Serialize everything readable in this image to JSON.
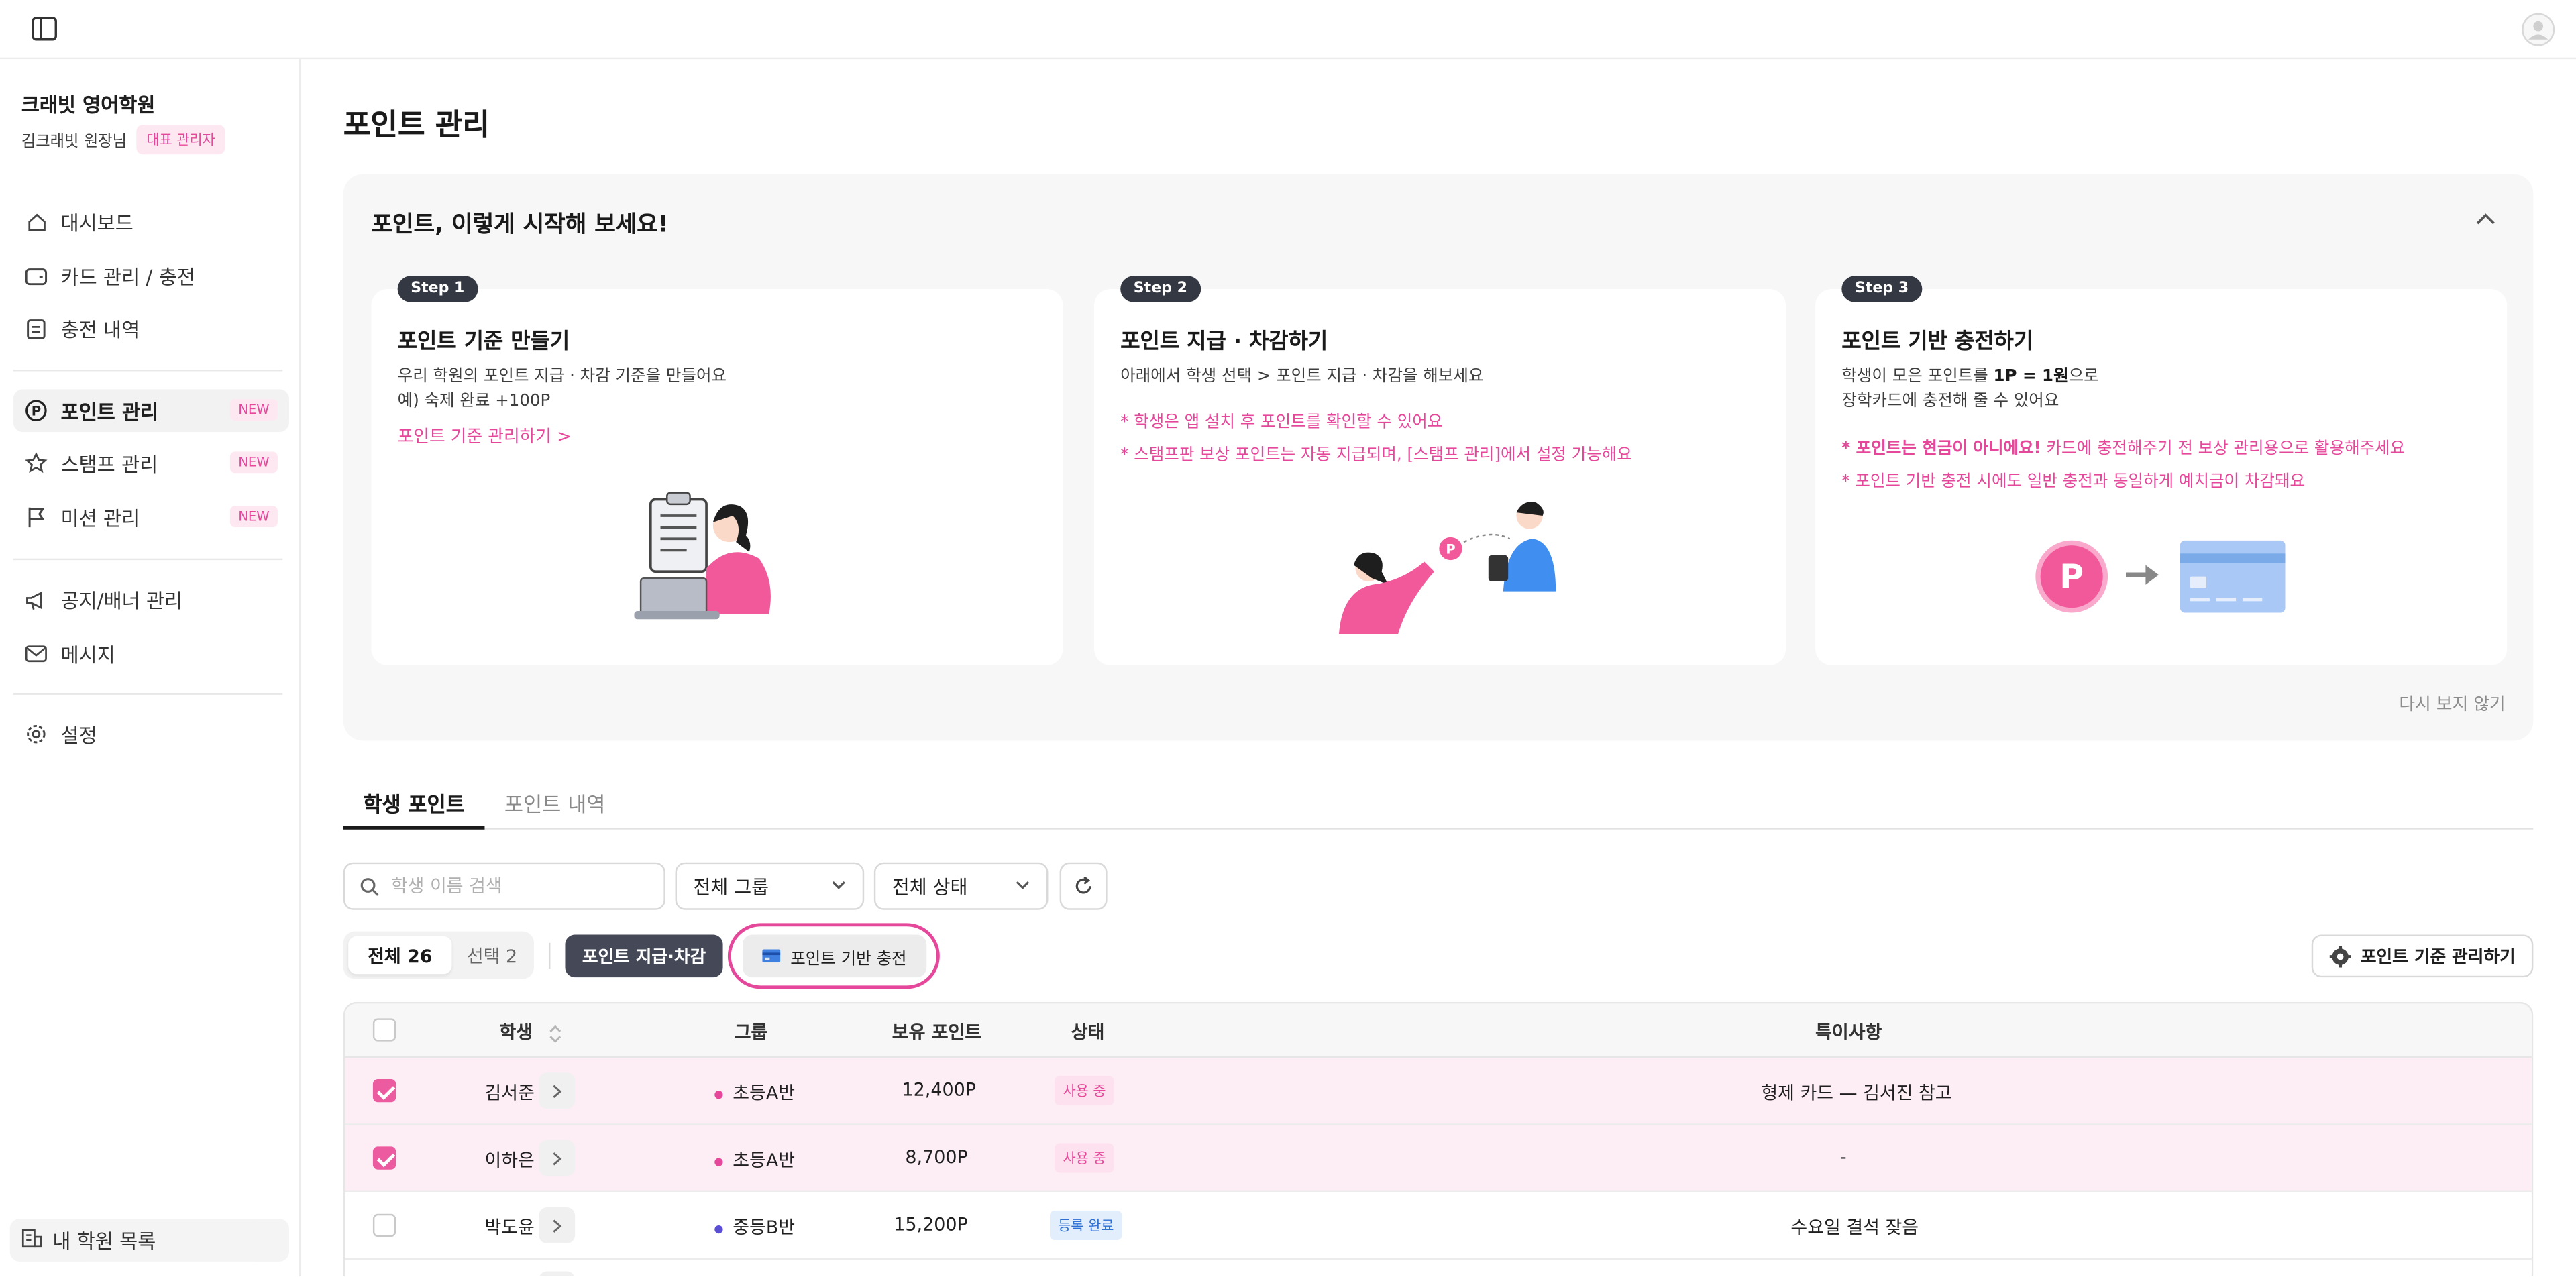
{
  "topbar": {
    "toggle_icon": "sidebar-toggle-icon",
    "avatar_icon": "user-avatar-icon"
  },
  "sidebar": {
    "academy_name": "크래빗 영어학원",
    "owner_name": "김크래빗 원장님",
    "role_badge": "대표 관리자",
    "items": [
      {
        "label": "대시보드",
        "icon": "home-icon",
        "new": ""
      },
      {
        "label": "카드 관리 / 충전",
        "icon": "wallet-icon",
        "new": ""
      },
      {
        "label": "충전 내역",
        "icon": "receipt-icon",
        "new": ""
      },
      {
        "label": "포인트 관리",
        "icon": "point-icon",
        "new": "NEW"
      },
      {
        "label": "스탬프 관리",
        "icon": "star-icon",
        "new": "NEW"
      },
      {
        "label": "미션 관리",
        "icon": "flag-icon",
        "new": "NEW"
      },
      {
        "label": "공지/배너 관리",
        "icon": "megaphone-icon",
        "new": ""
      },
      {
        "label": "메시지",
        "icon": "mail-icon",
        "new": ""
      },
      {
        "label": "설정",
        "icon": "gear-icon",
        "new": ""
      }
    ],
    "bottom_item": "내 학원 목록"
  },
  "page": {
    "title": "포인트 관리"
  },
  "guide": {
    "title": "포인트, 이렇게 시작해 보세요!",
    "dismiss": "다시 보지 않기",
    "steps": [
      {
        "badge": "Step 1",
        "title": "포인트 기준 만들기",
        "desc1": "우리 학원의 포인트 지급 · 차감 기준을 만들어요",
        "desc2": "예) 숙제 완료 +100P",
        "link": "포인트 기준 관리하기 >"
      },
      {
        "badge": "Step 2",
        "title": "포인트 지급 · 차감하기",
        "desc1": "아래에서 학생 선택 > 포인트 지급 · 차감을 해보세요",
        "note1": "* 학생은 앱 설치 후 포인트를 확인할 수 있어요",
        "note2": "* 스탬프판 보상 포인트는 자동 지급되며, [스탬프 관리]에서 설정 가능해요"
      },
      {
        "badge": "Step 3",
        "title": "포인트 기반 충전하기",
        "desc1_a": "학생이 모은 포인트를 ",
        "desc1_b": "1P = 1원",
        "desc1_c": "으로",
        "desc2": "장학카드에 충전해 줄 수 있어요",
        "note1_a": "* 포인트는 현금이 아니에요!",
        "note1_b": " 카드에 충전해주기 전 보상 관리용으로 활용해주세요",
        "note2": "* 포인트 기반 충전 시에도 일반 충전과 동일하게 예치금이 차감돼요",
        "coin_label": "P"
      }
    ]
  },
  "tabs": [
    {
      "label": "학생 포인트"
    },
    {
      "label": "포인트 내역"
    }
  ],
  "filters": {
    "search_placeholder": "학생 이름 검색",
    "group_select": "전체 그룹",
    "status_select": "전체 상태"
  },
  "toolbar": {
    "all_label": "전체 26",
    "selected_label": "선택 2",
    "grant_button": "포인트 지급·차감",
    "charge_button": "포인트 기반 충전",
    "criteria_button": "포인트 기준 관리하기"
  },
  "table": {
    "headers": [
      "학생",
      "그룹",
      "보유 포인트",
      "상태",
      "특이사항"
    ],
    "rows": [
      {
        "checked": true,
        "name": "김서준",
        "group": "초등A반",
        "group_color": "#e5489a",
        "points": "12,400P",
        "status": "사용 중",
        "note": "형제 카드 — 김서진 참고"
      },
      {
        "checked": true,
        "name": "이하은",
        "group": "초등A반",
        "group_color": "#e5489a",
        "points": "8,700P",
        "status": "사용 중",
        "note": "-"
      },
      {
        "checked": false,
        "name": "박도윤",
        "group": "중등B반",
        "group_color": "#5b4fd6",
        "points": "15,200P",
        "status": "등록 완료",
        "note": "수요일 결석 잦음"
      }
    ]
  },
  "colors": {
    "accent": "#e5489a",
    "dark_button": "#444857"
  }
}
